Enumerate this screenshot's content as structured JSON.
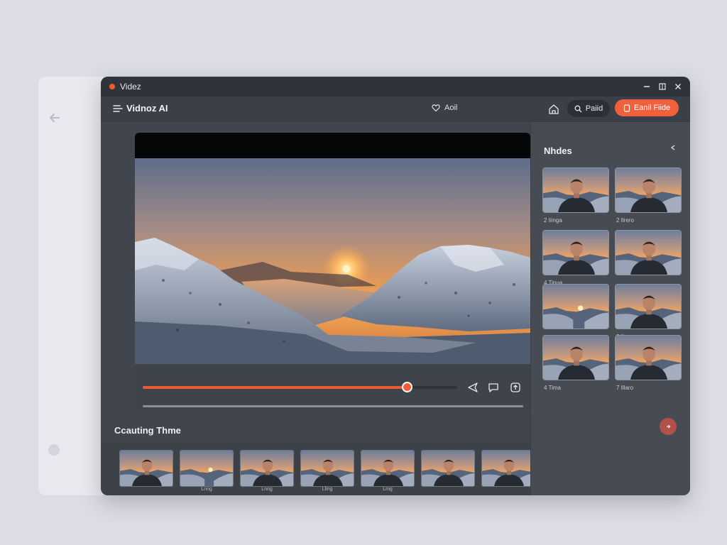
{
  "window": {
    "title": "Videz",
    "controls": [
      "minimize-icon",
      "maximize-icon",
      "close-icon"
    ]
  },
  "toolbar": {
    "brand": "Vidnoz AI",
    "center_label": "Aoil",
    "pill_label": "Paiid",
    "cta_label": "Eanil Fiide"
  },
  "player": {
    "progress": 0.84,
    "controls": [
      "send-icon",
      "chat-icon",
      "share-icon"
    ]
  },
  "timeline": {
    "title": "Ccauting Thme",
    "frames": [
      {
        "label": "",
        "kind": "person"
      },
      {
        "label": "Lnng",
        "kind": "landscape"
      },
      {
        "label": "Lnng",
        "kind": "person"
      },
      {
        "label": "Lling",
        "kind": "person"
      },
      {
        "label": "Lmg",
        "kind": "person"
      },
      {
        "label": "",
        "kind": "person"
      },
      {
        "label": "",
        "kind": "person"
      }
    ]
  },
  "sidebar": {
    "title": "Nhdes",
    "thumbnails": [
      {
        "label": "2 Iiinga",
        "kind": "person"
      },
      {
        "label": "2 Ilrero",
        "kind": "person"
      },
      {
        "label": "4 Tinua",
        "kind": "person"
      },
      {
        "label": "",
        "kind": "person"
      },
      {
        "label": "",
        "kind": "landscape"
      },
      {
        "label": "2 Ilmena",
        "kind": "person"
      },
      {
        "label": "4 Tima",
        "kind": "person"
      },
      {
        "label": "7 Illaro",
        "kind": "person"
      }
    ]
  },
  "colors": {
    "accent": "#f0603c",
    "window_bg": "#41464e",
    "titlebar_bg": "#2f333a",
    "sidebar_bg": "#474c54"
  }
}
